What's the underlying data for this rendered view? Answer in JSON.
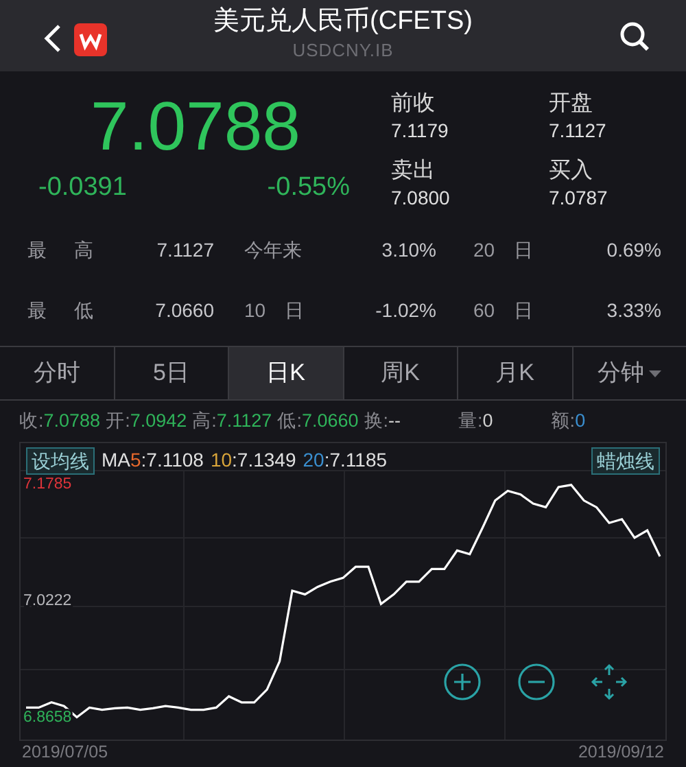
{
  "header": {
    "title": "美元兑人民币(CFETS)",
    "subtitle": "USDCNY.IB"
  },
  "quote": {
    "price": "7.0788",
    "change": "-0.0391",
    "change_pct": "-0.55%",
    "details": [
      {
        "label": "前收",
        "value": "7.1179"
      },
      {
        "label": "开盘",
        "value": "7.1127"
      },
      {
        "label": "卖出",
        "value": "7.0800"
      },
      {
        "label": "买入",
        "value": "7.0787"
      }
    ]
  },
  "stats": [
    {
      "label": "最 高",
      "value": "7.1127"
    },
    {
      "label": "今年来",
      "value": "3.10%"
    },
    {
      "label": "20 日",
      "value": "0.69%"
    },
    {
      "label": "最 低",
      "value": "7.0660"
    },
    {
      "label": "10 日",
      "value": "-1.02%"
    },
    {
      "label": "60 日",
      "value": "3.33%"
    }
  ],
  "tabs": [
    {
      "label": "分时",
      "selected": false
    },
    {
      "label": "5日",
      "selected": false
    },
    {
      "label": "日K",
      "selected": true
    },
    {
      "label": "周K",
      "selected": false
    },
    {
      "label": "月K",
      "selected": false
    },
    {
      "label": "分钟",
      "selected": false,
      "dropdown": true
    }
  ],
  "day_info": [
    {
      "label": "收:",
      "value": "7.0788",
      "color": "#2fb45a"
    },
    {
      "label": "开:",
      "value": "7.0942",
      "color": "#2fb45a"
    },
    {
      "label": "高:",
      "value": "7.1127",
      "color": "#2fb45a"
    },
    {
      "label": "低:",
      "value": "7.0660",
      "color": "#2fb45a"
    },
    {
      "label": "换:",
      "value": "--",
      "color": "#d0d0d0"
    },
    {
      "label": "量:",
      "value": "0",
      "color": "#d0d0d0"
    },
    {
      "label": "额:",
      "value": "0",
      "color": "#3a8fd0"
    }
  ],
  "chart": {
    "ma_button": "设均线",
    "style_button": "蜡烛线",
    "ma_lines": [
      {
        "prefix": "MA",
        "period": "5",
        "value": ":7.1108",
        "color": "#e8692c"
      },
      {
        "period": "10",
        "value": ":7.1349",
        "color": "#d9a53a"
      },
      {
        "period": "20",
        "value": ":7.1185",
        "color": "#3a8fd0"
      }
    ],
    "chart_data": {
      "type": "line",
      "ylim": [
        6.836,
        7.234
      ],
      "yticks": [
        6.8658,
        7.0222,
        7.1785
      ],
      "series": [
        {
          "color": "#ffffff",
          "values": [
            6.879,
            6.879,
            6.886,
            6.881,
            6.866,
            6.879,
            6.876,
            6.878,
            6.879,
            6.876,
            6.878,
            6.881,
            6.879,
            6.876,
            6.876,
            6.879,
            6.894,
            6.886,
            6.886,
            6.903,
            6.941,
            7.036,
            7.031,
            7.041,
            7.048,
            7.053,
            7.068,
            7.068,
            7.018,
            7.031,
            7.048,
            7.048,
            7.065,
            7.065,
            7.09,
            7.085,
            7.12,
            7.157,
            7.17,
            7.165,
            7.153,
            7.148,
            7.175,
            7.178,
            7.157,
            7.148,
            7.127,
            7.132,
            7.107,
            7.117,
            7.082
          ]
        }
      ]
    },
    "dates": [
      "2019/07/05",
      "2019/09/12"
    ]
  }
}
